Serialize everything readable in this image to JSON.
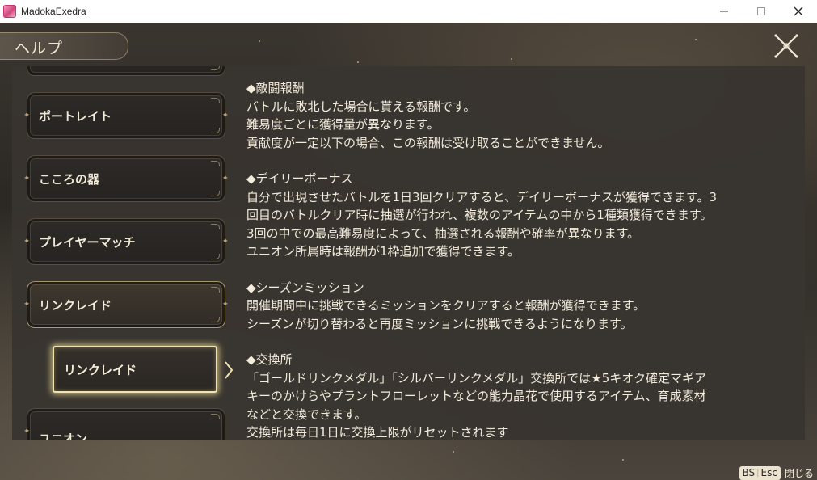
{
  "window": {
    "title": "MadokaExedra",
    "minimize_icon": "minimize-icon",
    "maximize_icon": "maximize-icon",
    "close_icon": "close-icon"
  },
  "header": {
    "title": "ヘルプ",
    "close_icon": "close-x-icon"
  },
  "menu": {
    "items": [
      {
        "label": "ポートレイト"
      },
      {
        "label": "こころの器"
      },
      {
        "label": "プレイヤーマッチ"
      },
      {
        "label": "リンクレイド"
      },
      {
        "label": "ユニオン"
      }
    ],
    "sub_item": {
      "label": "リンクレイド"
    }
  },
  "content": {
    "sections": [
      {
        "heading": "◆敵闘報酬",
        "lines": [
          "バトルに敗北した場合に貰える報酬です。",
          "難易度ごとに獲得量が異なります。",
          "貢献度が一定以下の場合、この報酬は受け取ることができません。"
        ]
      },
      {
        "heading": "◆デイリーボーナス",
        "lines": [
          "自分で出現させたバトルを1日3回クリアすると、デイリーボーナスが獲得できます。3",
          "回目のバトルクリア時に抽選が行われ、複数のアイテムの中から1種類獲得できます。",
          "3回の中での最高難易度によって、抽選される報酬や確率が異なります。",
          "ユニオン所属時は報酬が1枠追加で獲得できます。"
        ]
      },
      {
        "heading": "◆シーズンミッション",
        "lines": [
          "開催期間中に挑戦できるミッションをクリアすると報酬が獲得できます。",
          "シーズンが切り替わると再度ミッションに挑戦できるようになります。"
        ]
      },
      {
        "heading": "◆交換所",
        "lines": [
          "「ゴールドリンクメダル」「シルバーリンクメダル」交換所では★5キオク確定マギア",
          "キーのかけらやプラントフローレットなどの能力晶花で使用するアイテム、育成素材",
          "などと交換できます。",
          "交換所は毎日1日に交換上限がリセットされます"
        ]
      }
    ]
  },
  "footer": {
    "key1": "BS",
    "key_sep": "|",
    "key2": "Esc",
    "action": "閉じる"
  },
  "colors": {
    "panel_bg": "#38342f",
    "text": "#f3ecdc",
    "gold_border": "#efe3b2"
  }
}
